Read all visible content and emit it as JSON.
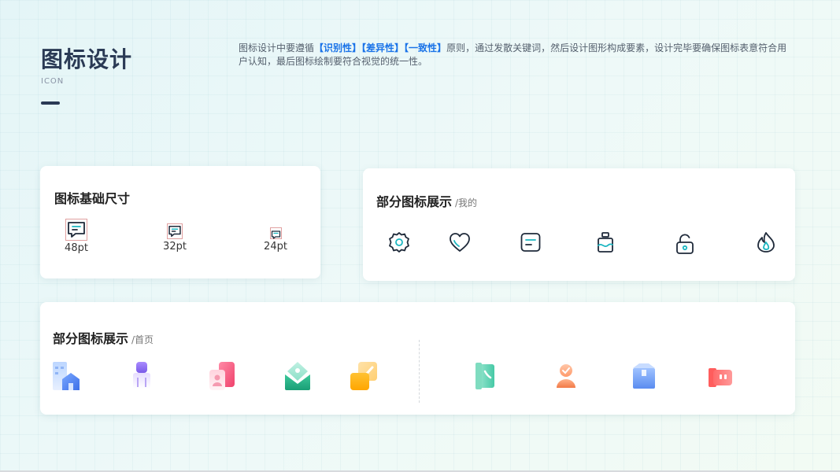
{
  "header": {
    "title": "图标设计",
    "subtitle": "ICON",
    "desc_prefix": "图标设计中要遵循",
    "desc_h1": "【识别性】",
    "desc_h2": "【差异性】",
    "desc_h3": "【一致性】",
    "desc_suffix": "原则，通过发散关键词，然后设计图形构成要素，设计完毕要确保图标表意符合用户认知，最后图标绘制要符合视觉的统一性。"
  },
  "size_card": {
    "title": "图标基础尺寸",
    "sizes": [
      {
        "label": "48pt",
        "icon": "chat-bubble-icon"
      },
      {
        "label": "32pt",
        "icon": "chat-bubble-icon"
      },
      {
        "label": "24pt",
        "icon": "chat-bubble-icon"
      }
    ]
  },
  "mine_card": {
    "title": "部分图标展示",
    "suffix": "/我的",
    "icons": [
      "settings-gear-icon",
      "heart-icon",
      "message-card-icon",
      "bottle-icon",
      "unlock-icon",
      "flame-icon"
    ]
  },
  "home_card": {
    "title": "部分图标展示",
    "suffix": "/首页",
    "icons": [
      "buildings-icon",
      "lamp-icon",
      "contact-card-icon",
      "location-envelope-icon",
      "edit-note-icon",
      "phone-book-icon",
      "user-badge-icon",
      "package-icon",
      "vote-icon"
    ]
  },
  "colors": {
    "title": "#2a3a55",
    "highlight": "#1a73e8",
    "icon_stroke": "#1f2a3a",
    "icon_accent": "#1bb6c1"
  }
}
